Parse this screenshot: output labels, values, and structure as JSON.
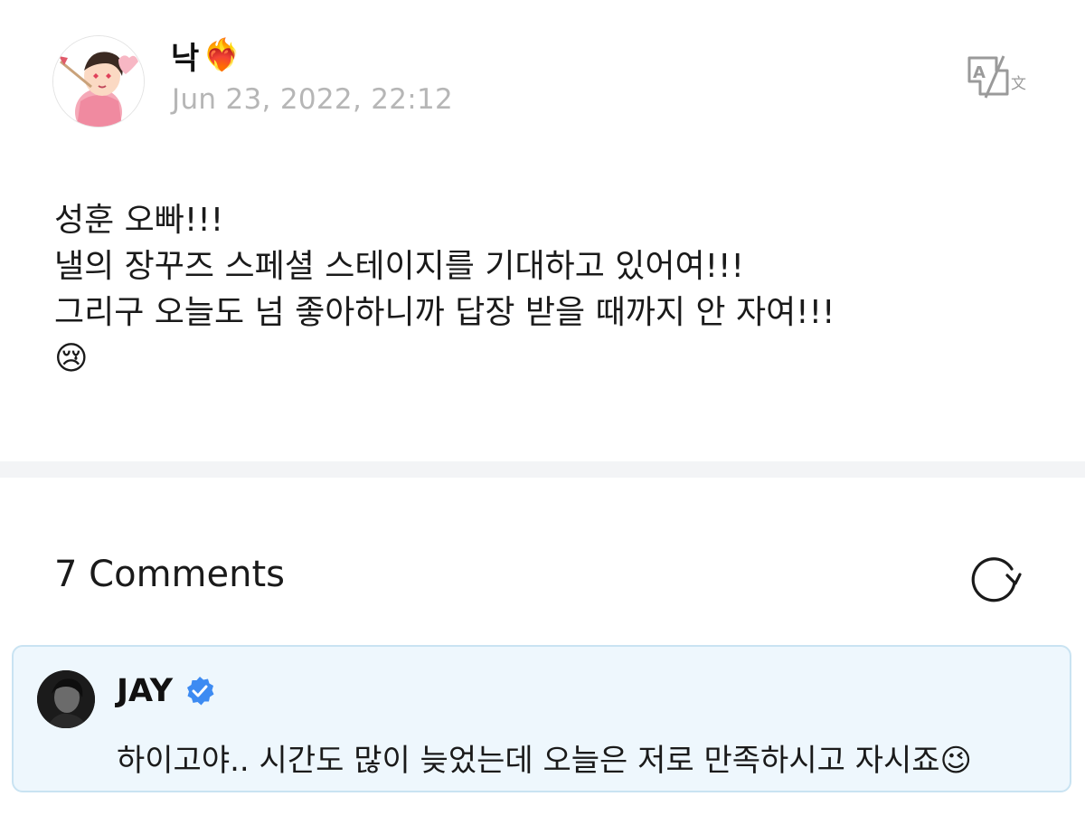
{
  "post": {
    "author_name": "낙",
    "author_emoji": "❤️‍🔥",
    "date": "Jun 23, 2022, 22:12",
    "translate_icon": "translate-icon",
    "body_lines": [
      "성훈 오빠!!!",
      "낼의 장꾸즈 스페셜 스테이지를 기대하고 있어여!!!",
      "그리구 오늘도 넘 좋아하니까 답장 받을 때까지 안 자여!!!",
      "😢"
    ]
  },
  "comments": {
    "count_label": "7 Comments",
    "refresh_icon": "refresh-icon",
    "items": [
      {
        "author": "JAY",
        "verified_icon": "verified-badge-icon",
        "text": "하이고야.. 시간도 많이 늦었는데 오늘은 저로 만족하시고 자시죠😉"
      }
    ]
  },
  "colors": {
    "date_gray": "#b6b6b6",
    "divider": "#f3f4f6",
    "comment_bg": "#eef7fd",
    "comment_border": "#c9e3f2",
    "verified_blue": "#3d8bf2"
  }
}
